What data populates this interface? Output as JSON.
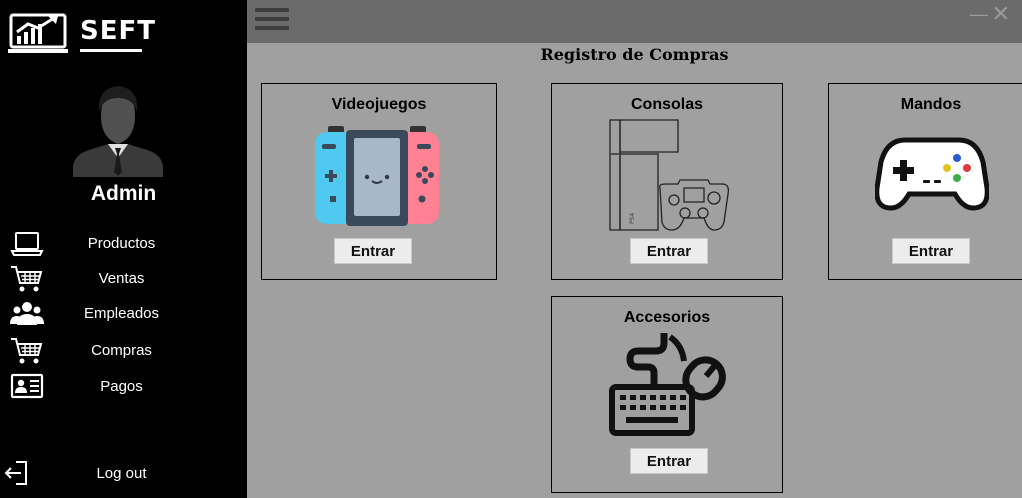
{
  "sidebar": {
    "brand": "SEFT",
    "user_name": "Admin",
    "items": [
      {
        "label": "Productos",
        "icon": "laptop-icon"
      },
      {
        "label": "Ventas",
        "icon": "cart-icon"
      },
      {
        "label": "Empleados",
        "icon": "users-icon"
      },
      {
        "label": "Compras",
        "icon": "cart-icon"
      },
      {
        "label": "Pagos",
        "icon": "id-card-icon"
      }
    ],
    "logout": {
      "label": "Log out",
      "icon": "logout-icon"
    }
  },
  "topbar": {
    "menu_icon": "hamburger-menu-icon",
    "minimize_icon": "minimize-icon",
    "close_icon": "close-icon"
  },
  "page": {
    "title": "Registro de Compras",
    "cards": [
      {
        "title": "Videojuegos",
        "button": "Entrar",
        "icon": "nintendo-switch-icon"
      },
      {
        "title": "Consolas",
        "button": "Entrar",
        "icon": "console-gamepad-icon"
      },
      {
        "title": "Mandos",
        "button": "Entrar",
        "icon": "gamepad-icon"
      },
      {
        "title": "Accesorios",
        "button": "Entrar",
        "icon": "keyboard-mouse-icon"
      }
    ]
  },
  "colors": {
    "sidebar_bg": "#000000",
    "topbar_bg": "#6b6b6b",
    "content_bg": "#a0a0a0",
    "switch_blue": "#4fc9ef",
    "switch_pink": "#ff8193",
    "switch_body": "#3b4a5a"
  }
}
